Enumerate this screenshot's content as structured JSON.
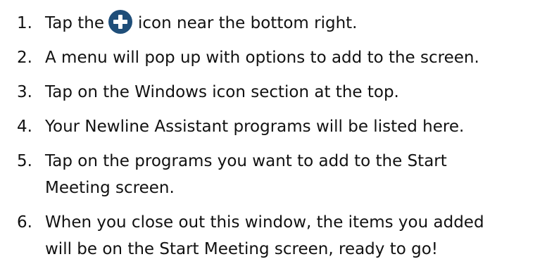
{
  "steps": [
    {
      "number": "1.",
      "before_icon": "Tap the",
      "icon": "plus-circle-icon",
      "after_icon": "icon near the bottom right."
    },
    {
      "number": "2.",
      "text": "A menu will pop up with options to add to the screen."
    },
    {
      "number": "3.",
      "text": "Tap on the Windows icon section at the top."
    },
    {
      "number": "4.",
      "text": "Your Newline Assistant programs will be listed here."
    },
    {
      "number": "5.",
      "line1": "Tap on the programs you want to add to the Start",
      "line2": "Meeting screen."
    },
    {
      "number": "6.",
      "line1": "When you close out this window, the items you added",
      "line2": "will be on the Start Meeting screen, ready to go!"
    }
  ],
  "colors": {
    "text": "#111111",
    "icon_fill": "#1f4e79",
    "icon_glyph": "#ffffff"
  }
}
